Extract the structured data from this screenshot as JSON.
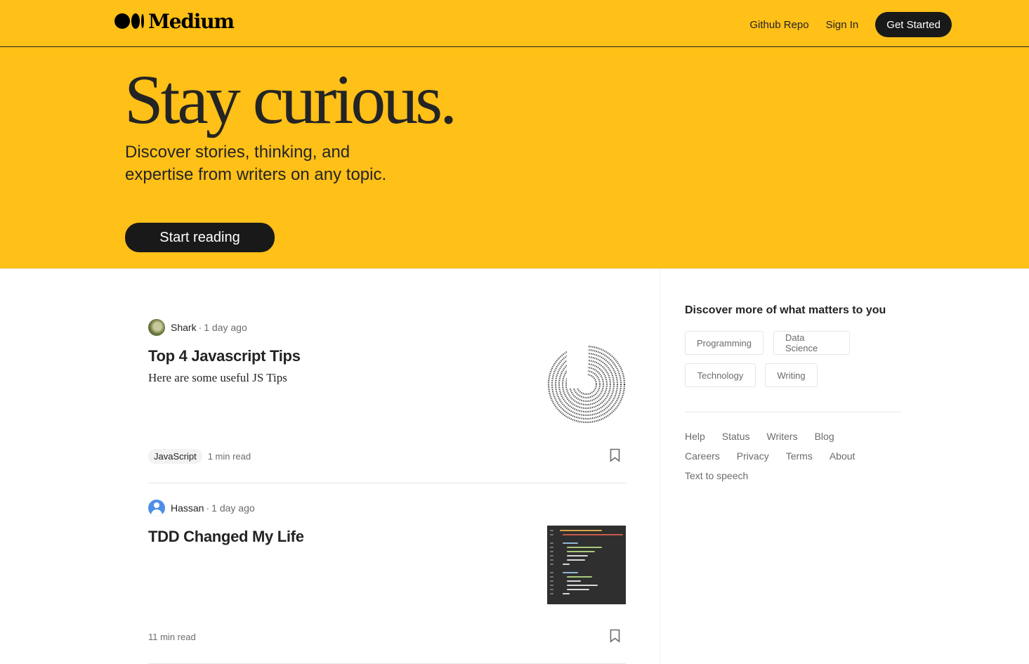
{
  "brand": {
    "name": "Medium"
  },
  "nav": {
    "github": "Github Repo",
    "signin": "Sign In",
    "get_started": "Get Started"
  },
  "hero": {
    "title": "Stay curious.",
    "subtitle": "Discover stories, thinking, and expertise from writers on any topic.",
    "cta": "Start reading"
  },
  "colors": {
    "accent": "#ffc017",
    "dark": "#191919"
  },
  "articles": [
    {
      "author": "Shark",
      "separator": "·",
      "ago": "1 day ago",
      "title": "Top 4 Javascript Tips",
      "subtitle": "Here are some useful JS Tips",
      "tag": "JavaScript",
      "read_time": "1 min read",
      "thumbnail": "circular-text-image",
      "bookmark_icon": "bookmark-icon"
    },
    {
      "author": "Hassan",
      "separator": "·",
      "ago": "1 day ago",
      "title": "TDD Changed My Life",
      "read_time": "11 min read",
      "thumbnail": "code-screenshot-image",
      "bookmark_icon": "bookmark-icon"
    }
  ],
  "sidebar": {
    "title": "Discover more of what matters to you",
    "topics": [
      "Programming",
      "Data Science",
      "Technology",
      "Writing"
    ],
    "footer_links": [
      "Help",
      "Status",
      "Writers",
      "Blog",
      "Careers",
      "Privacy",
      "Terms",
      "About",
      "Text to speech"
    ]
  }
}
